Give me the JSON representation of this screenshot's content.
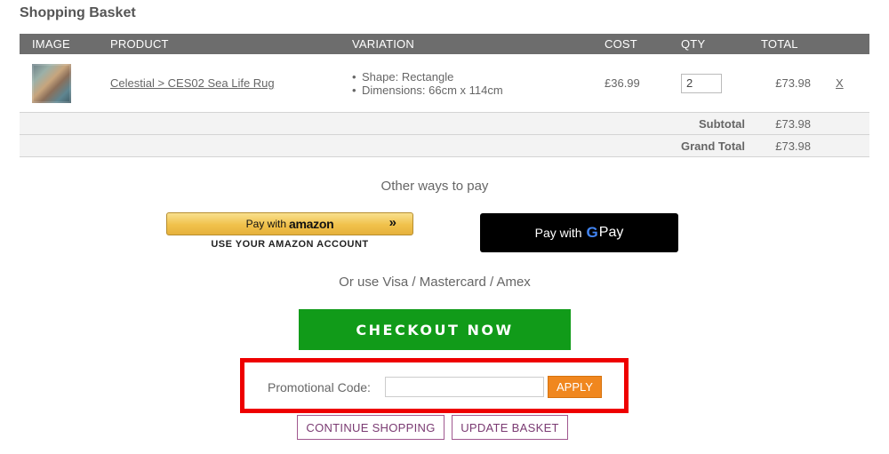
{
  "page": {
    "title": "Shopping Basket"
  },
  "table": {
    "headers": {
      "image": "IMAGE",
      "product": "PRODUCT",
      "variation": "VARIATION",
      "cost": "COST",
      "qty": "QTY",
      "total": "TOTAL"
    },
    "items": [
      {
        "product": "Celestial > CES02 Sea Life Rug",
        "variations": [
          "Shape: Rectangle",
          "Dimensions: 66cm x 114cm"
        ],
        "cost": "£36.99",
        "qty": "2",
        "total": "£73.98",
        "remove": "X"
      }
    ],
    "subtotal_label": "Subtotal",
    "subtotal": "£73.98",
    "grand_total_label": "Grand Total",
    "grand_total": "£73.98"
  },
  "payments": {
    "other_ways": "Other ways to pay",
    "amazon_prefix": "Pay with",
    "amazon_brand": "amazon",
    "amazon_chevron": "»",
    "amazon_sub": "USE YOUR AMAZON ACCOUNT",
    "gpay_prefix": "Pay with",
    "gpay_g": "G",
    "gpay_pay": "Pay",
    "or_use": "Or use Visa / Mastercard / Amex"
  },
  "checkout": {
    "label": "CHECKOUT NOW"
  },
  "promo": {
    "label": "Promotional Code:",
    "value": "",
    "apply": "APPLY"
  },
  "actions": {
    "continue": "CONTINUE SHOPPING",
    "update": "UPDATE BASKET"
  },
  "colors": {
    "checkout": "#119b19",
    "apply": "#f0871f",
    "promo_border": "#ee0000",
    "header_bg": "#6d6d6d"
  }
}
